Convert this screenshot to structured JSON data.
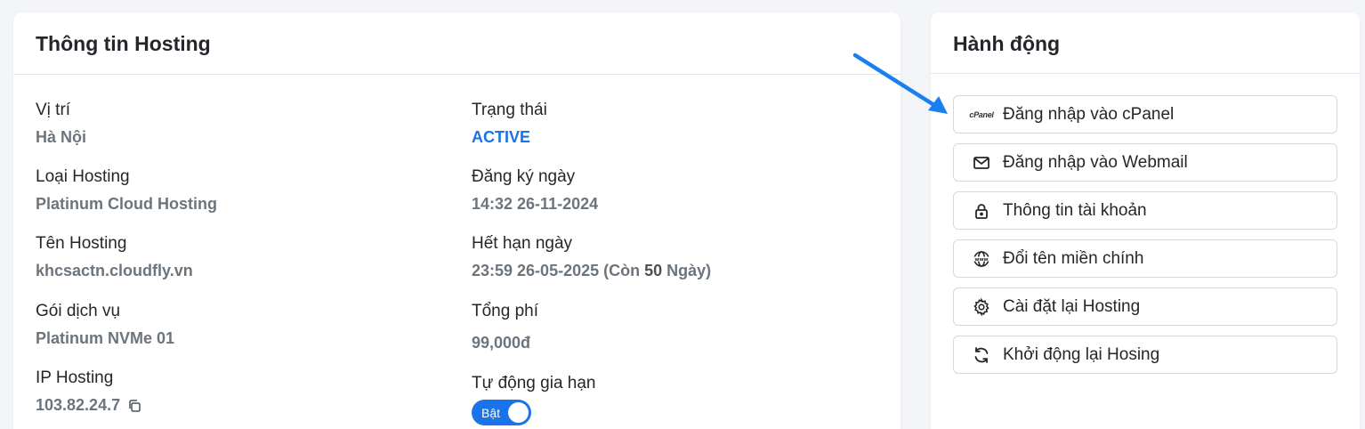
{
  "info": {
    "title": "Thông tin Hosting",
    "fields": {
      "location": {
        "label": "Vị trí",
        "value": "Hà Nội"
      },
      "status": {
        "label": "Trạng thái",
        "value": "ACTIVE"
      },
      "type": {
        "label": "Loại Hosting",
        "value": "Platinum Cloud Hosting"
      },
      "registered": {
        "label": "Đăng ký ngày",
        "value": "14:32 26-11-2024"
      },
      "name": {
        "label": "Tên Hosting",
        "value": "khcsactn.cloudfly.vn"
      },
      "expiry": {
        "label": "Hết hạn ngày",
        "value_prefix": "23:59 26-05-2025 (Còn ",
        "days": "50",
        "value_suffix": " Ngày)"
      },
      "package": {
        "label": "Gói dịch vụ",
        "value": "Platinum NVMe 01"
      },
      "total": {
        "label": "Tổng phí",
        "value": "99,000đ"
      },
      "ip": {
        "label": "IP Hosting",
        "value": "103.82.24.7"
      },
      "auto_renew": {
        "label": "Tự động gia hạn",
        "toggle_label": "Bật",
        "enabled": true
      }
    }
  },
  "actions": {
    "title": "Hành động",
    "cpanel_logo_text": "cPanel",
    "buttons": [
      {
        "label": "Đăng nhập vào cPanel",
        "icon": "cpanel-icon"
      },
      {
        "label": "Đăng nhập vào Webmail",
        "icon": "mail-icon"
      },
      {
        "label": "Thông tin tài khoản",
        "icon": "lock-icon"
      },
      {
        "label": "Đổi tên miền chính",
        "icon": "www-globe-icon"
      },
      {
        "label": "Cài đặt lại Hosting",
        "icon": "gear-icon"
      },
      {
        "label": "Khởi động lại Hosing",
        "icon": "refresh-icon"
      }
    ]
  },
  "colors": {
    "accent": "#1a73e8",
    "muted": "#6c757d",
    "background": "#f3f5f8"
  }
}
